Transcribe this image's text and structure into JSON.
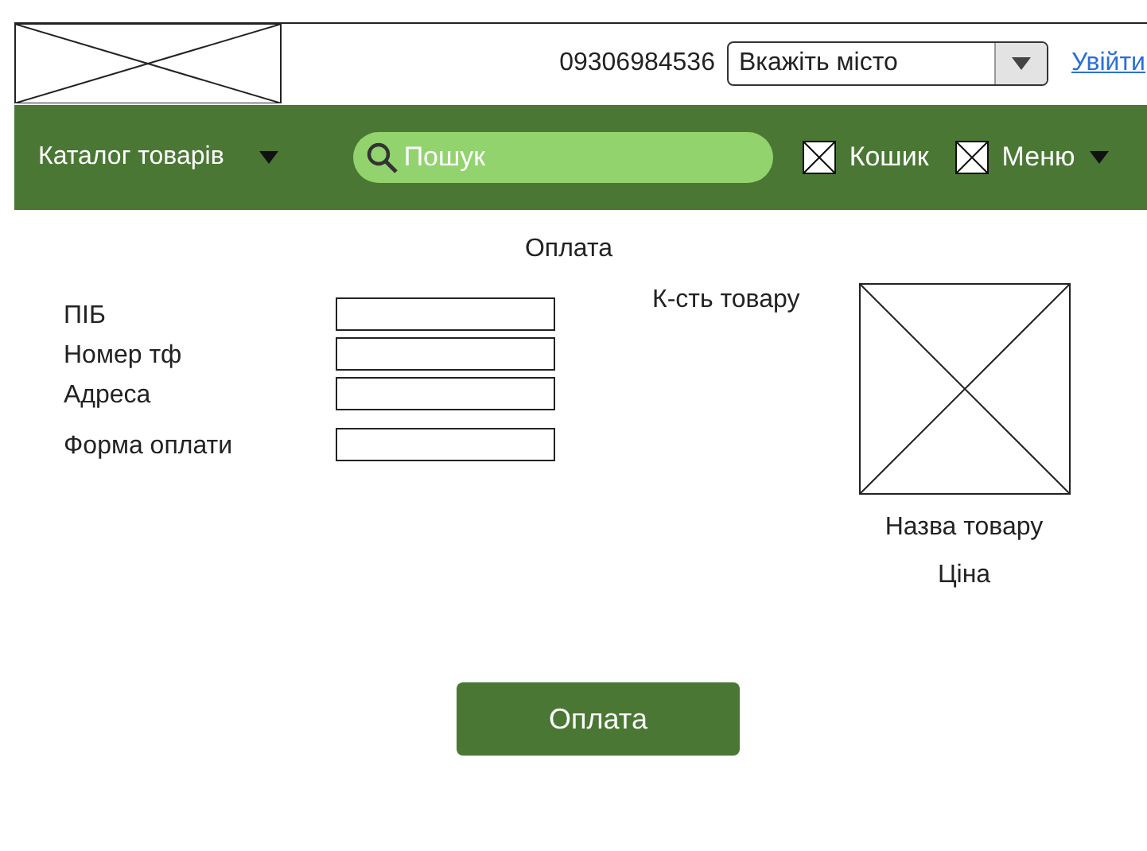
{
  "header": {
    "phone": "09306984536",
    "city_select": {
      "value": "Вкажіть місто"
    },
    "login_link": "Увійти"
  },
  "nav": {
    "catalog": "Каталог товарів",
    "search": {
      "placeholder": "Пошук"
    },
    "cart": "Кошик",
    "menu": "Меню"
  },
  "title": "Оплата",
  "form": {
    "fields": [
      {
        "label": "ПІБ"
      },
      {
        "label": "Номер тф"
      },
      {
        "label": "Адреса"
      },
      {
        "label": "Форма оплати"
      }
    ]
  },
  "quantity_label": "К-сть товару",
  "product": {
    "name": "Назва товару",
    "price": "Ціна"
  },
  "pay_button": "Оплата"
}
